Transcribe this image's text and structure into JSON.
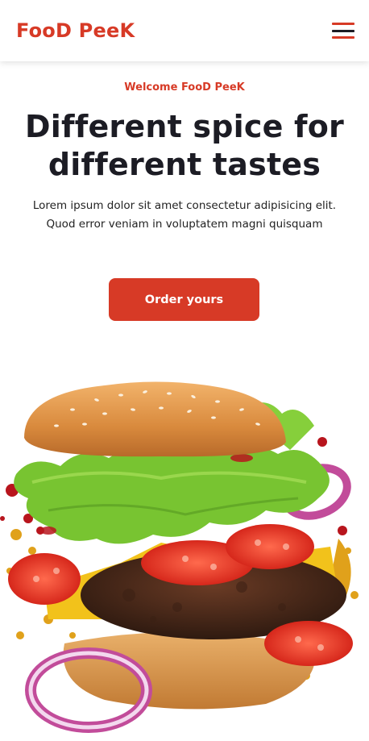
{
  "brand": {
    "part1": "Foo",
    "part2": "D",
    "part3": " Pee",
    "part4": "K"
  },
  "nav": {
    "menu_icon": "hamburger-menu-icon"
  },
  "hero": {
    "eyebrow": "Welcome FooD PeeK",
    "headline_line1": "Different spice for",
    "headline_line2": "different tastes",
    "subtext_line1": "Lorem ipsum dolor sit amet consectetur adipisicing elit.",
    "subtext_line2": "Quod error veniam in voluptatem magni quisquam",
    "cta_label": "Order yours"
  },
  "colors": {
    "accent": "#d73a26",
    "dark": "#1c1c24"
  }
}
